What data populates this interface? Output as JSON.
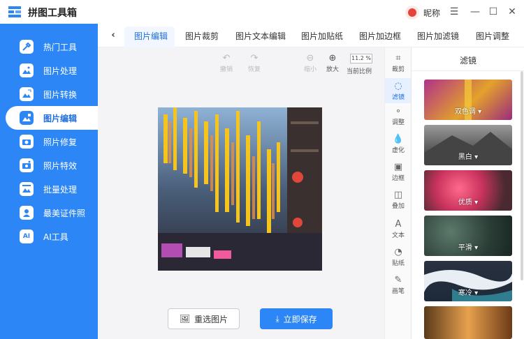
{
  "app": {
    "title": "拼图工具箱",
    "nickname": "昵称",
    "window_controls": [
      "☰",
      "—",
      "☐",
      "✕"
    ]
  },
  "sidebar": {
    "items": [
      {
        "label": "热门工具",
        "icon": "tools-icon"
      },
      {
        "label": "图片处理",
        "icon": "image-icon"
      },
      {
        "label": "图片转换",
        "icon": "image-convert-icon"
      },
      {
        "label": "图片编辑",
        "icon": "image-edit-icon",
        "active": true
      },
      {
        "label": "照片修复",
        "icon": "camera-icon"
      },
      {
        "label": "照片特效",
        "icon": "camera-effect-icon"
      },
      {
        "label": "批量处理",
        "icon": "batch-icon"
      },
      {
        "label": "最美证件照",
        "icon": "id-photo-icon"
      },
      {
        "label": "AI工具",
        "icon": "ai-icon"
      }
    ]
  },
  "tabs": {
    "items": [
      "图片编辑",
      "图片裁剪",
      "图片文本编辑",
      "图片加贴纸",
      "图片加边框",
      "图片加滤镜",
      "图片调整"
    ],
    "active": 0
  },
  "toolbar": {
    "undo": "撤销",
    "redo": "恢复",
    "zoom_out": "缩小",
    "zoom_in": "放大",
    "zoom_value": "11.2 %",
    "current_ratio": "当前比例"
  },
  "actions": {
    "reselect": "重选图片",
    "save": "立即保存"
  },
  "rail": {
    "items": [
      {
        "label": "裁剪",
        "icon": "crop-icon",
        "glyph": "⌗"
      },
      {
        "label": "滤镜",
        "icon": "filter-icon",
        "glyph": "◌",
        "active": true
      },
      {
        "label": "调整",
        "icon": "adjust-icon",
        "glyph": "∘"
      },
      {
        "label": "虚化",
        "icon": "blur-icon",
        "glyph": "💧"
      },
      {
        "label": "边框",
        "icon": "frame-icon",
        "glyph": "▣"
      },
      {
        "label": "叠加",
        "icon": "overlay-icon",
        "glyph": "◫"
      },
      {
        "label": "文本",
        "icon": "text-icon",
        "glyph": "A"
      },
      {
        "label": "贴纸",
        "icon": "sticker-icon",
        "glyph": "◔"
      },
      {
        "label": "画笔",
        "icon": "brush-icon",
        "glyph": "✎"
      }
    ]
  },
  "filter_panel": {
    "title": "滤镜",
    "filters": [
      "双色调 ▾",
      "黑白 ▾",
      "优质 ▾",
      "平滑 ▾",
      "寒冷 ▾"
    ]
  },
  "colors": {
    "brand_blue": "#2d86f5",
    "active_text": "#1f6fe0"
  }
}
